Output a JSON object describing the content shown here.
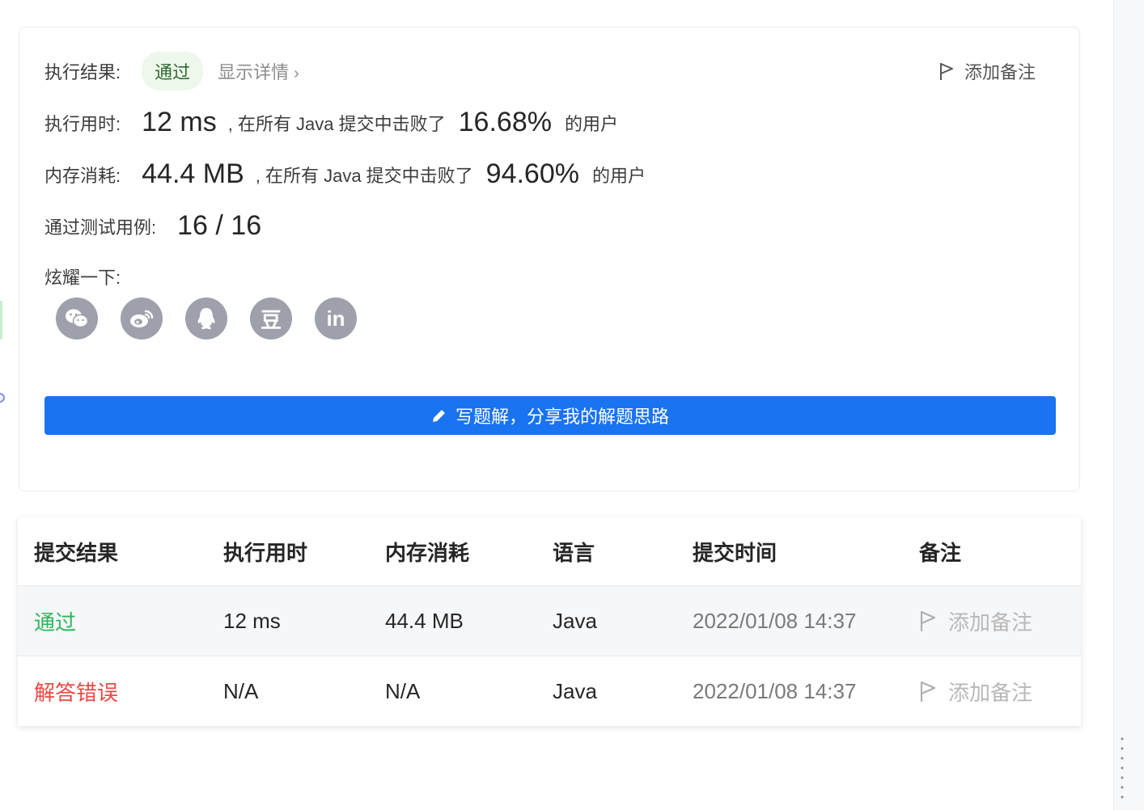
{
  "result": {
    "status_label": "执行结果:",
    "status_value": "通过",
    "details_link": "显示详情",
    "add_note": "添加备注",
    "runtime_label": "执行用时:",
    "runtime_value": "12 ms",
    "runtime_compare": ", 在所有 Java 提交中击败了",
    "runtime_percent": "16.68%",
    "runtime_suffix": "的用户",
    "memory_label": "内存消耗:",
    "memory_value": "44.4 MB",
    "memory_compare": ", 在所有 Java 提交中击败了",
    "memory_percent": "94.60%",
    "memory_suffix": "的用户",
    "tests_label": "通过测试用例:",
    "tests_value": "16 / 16",
    "share_label": "炫耀一下:",
    "share_icons": [
      "wechat-icon",
      "weibo-icon",
      "qq-icon",
      "douban-icon",
      "linkedin-icon"
    ],
    "douban_glyph": "豆",
    "linkedin_glyph": "in",
    "solution_button": "写题解，分享我的解题思路"
  },
  "submissions": {
    "headers": [
      "提交结果",
      "执行用时",
      "内存消耗",
      "语言",
      "提交时间",
      "备注"
    ],
    "rows": [
      {
        "status": "通过",
        "runtime": "12 ms",
        "memory": "44.4 MB",
        "language": "Java",
        "time": "2022/01/08 14:37",
        "note": "添加备注"
      },
      {
        "status": "解答错误",
        "runtime": "N/A",
        "memory": "N/A",
        "language": "Java",
        "time": "2022/01/08 14:37",
        "note": "添加备注"
      }
    ]
  },
  "colors": {
    "accent": "#1a73f0",
    "success": "#2db55d",
    "error": "#ef4743",
    "share_icon_bg": "#9ea1ab"
  }
}
